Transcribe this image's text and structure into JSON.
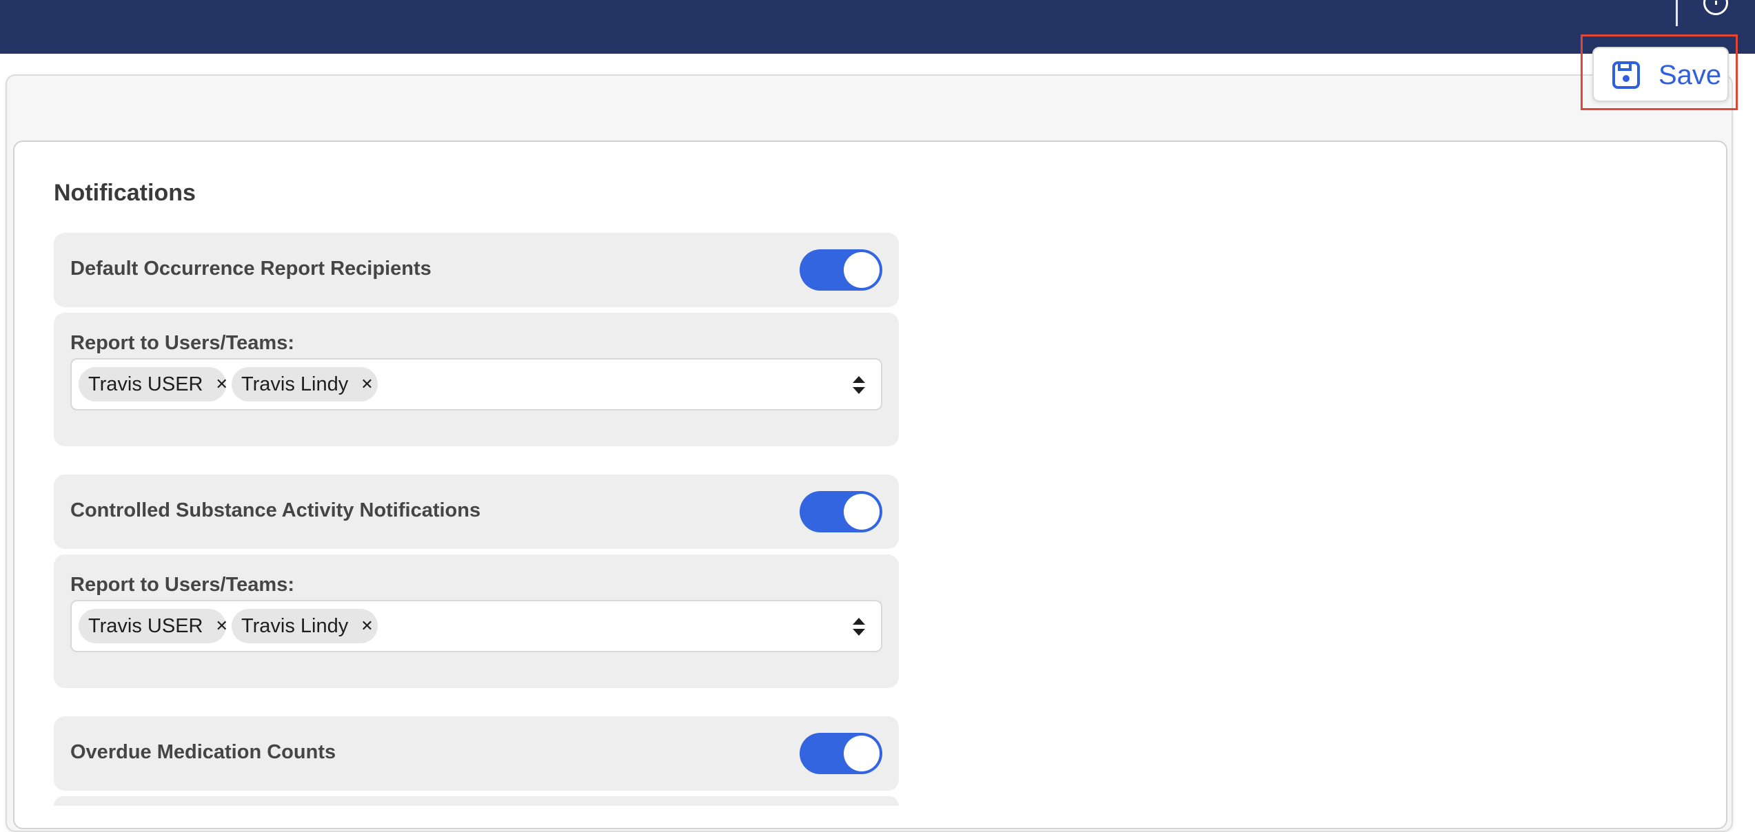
{
  "header": {
    "help_icon": "help-circle-icon"
  },
  "toolbar": {
    "save_label": "Save",
    "save_icon": "floppy-disk-icon"
  },
  "notifications": {
    "title": "Notifications",
    "sections": [
      {
        "label": "Default Occurrence Report Recipients",
        "enabled": true,
        "recipients_label": "Report to Users/Teams:",
        "recipients": [
          "Travis USER",
          "Travis Lindy"
        ]
      },
      {
        "label": "Controlled Substance Activity Notifications",
        "enabled": true,
        "recipients_label": "Report to Users/Teams:",
        "recipients": [
          "Travis USER",
          "Travis Lindy"
        ]
      },
      {
        "label": "Overdue Medication Counts",
        "enabled": true
      }
    ]
  },
  "colors": {
    "header_bg": "#233465",
    "accent": "#3465e1",
    "save_text": "#2f5fdc",
    "highlight_border": "#e04637"
  }
}
